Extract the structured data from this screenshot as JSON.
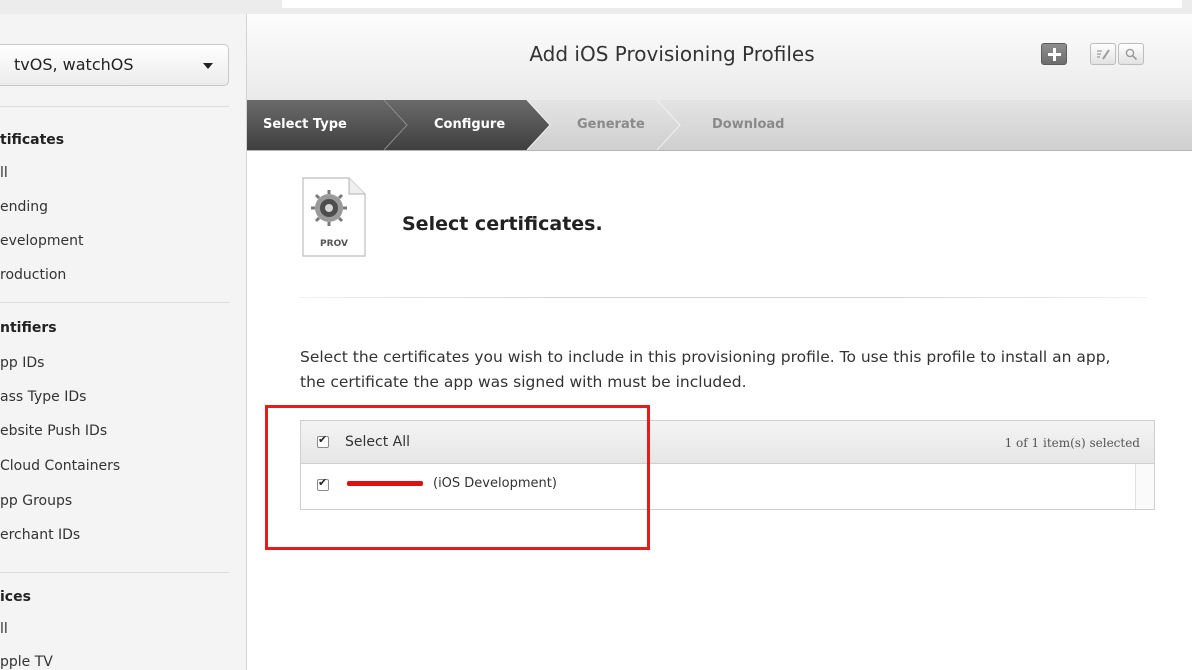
{
  "sidebar": {
    "platform_select": "tvOS, watchOS",
    "sections": [
      {
        "title": "tificates",
        "items": [
          "ll",
          "ending",
          "evelopment",
          "roduction"
        ]
      },
      {
        "title": "ntifiers",
        "items": [
          "pp IDs",
          "ass Type IDs",
          "ebsite Push IDs",
          "Cloud Containers",
          "pp Groups",
          "erchant IDs"
        ]
      },
      {
        "title": "ices",
        "items": [
          "ll",
          "pple TV"
        ]
      }
    ]
  },
  "header": {
    "title": "Add iOS Provisioning Profiles",
    "buttons": [
      {
        "name": "add-button",
        "icon": "plus-icon"
      },
      {
        "name": "edit-button",
        "icon": "edit-icon"
      },
      {
        "name": "search-button",
        "icon": "search-icon"
      }
    ]
  },
  "steps": [
    {
      "label": "Select Type",
      "state": "done"
    },
    {
      "label": "Configure",
      "state": "current"
    },
    {
      "label": "Generate",
      "state": "todo"
    },
    {
      "label": "Download",
      "state": "todo"
    }
  ],
  "content": {
    "file_icon_label": "PROV",
    "heading": "Select certificates.",
    "description": "Select the certificates you wish to include in this provisioning profile. To use this profile to install an app, the certificate the app was signed with must be included.",
    "table": {
      "select_all_label": "Select All",
      "selected_count": "1  of 1 item(s) selected",
      "rows": [
        {
          "name_redacted": true,
          "type": "(iOS Development)",
          "checked": true
        }
      ],
      "select_all_checked": true
    }
  },
  "colors": {
    "step_active": "#4a4a4a",
    "highlight_box": "#e81b1b",
    "redaction": "#e01010"
  }
}
